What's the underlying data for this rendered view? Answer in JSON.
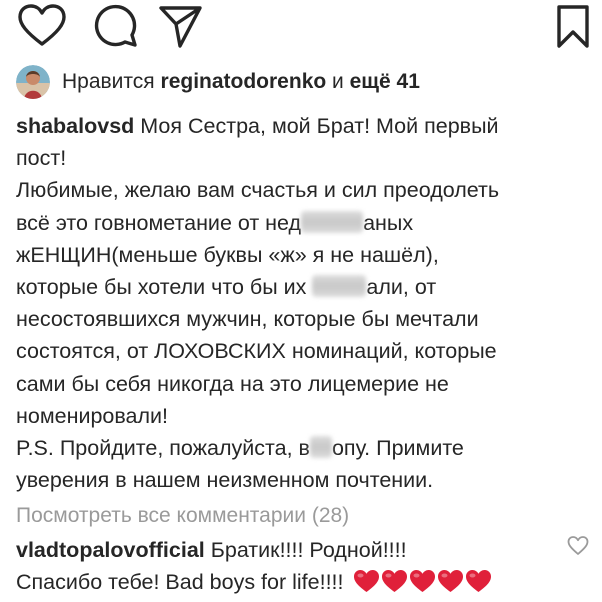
{
  "action_bar": {
    "icons": [
      "heart-icon",
      "comment-icon",
      "share-icon",
      "bookmark-icon"
    ]
  },
  "likes": {
    "prefix": "Нравится",
    "user": "reginatodorenko",
    "middle": "и",
    "more": "ещё 41"
  },
  "caption": {
    "username": "shabalovsd",
    "lines": [
      "Моя Сестра, мой Брат! Мой первый",
      "пост!",
      "Любимые, желаю вам счастья и сил преодолеть",
      "всё это говнометание от нед",
      "аных",
      "жЕНЩИН(меньше буквы «ж» я не нашёл),",
      "которые бы хотели что бы их",
      "али, от",
      "несостоявшихся мужчин, которые  бы мечтали",
      "состоятся, от ЛОХОВСКИХ номинаций, которые",
      "сами бы себя никогда на это лицемерие не",
      "номенировали!",
      "P.S. Пройдите, пожалуйста, в",
      "опу. Примите",
      "уверения в нашем неизменном почтении."
    ]
  },
  "view_comments": "Посмотреть все комментарии (28)",
  "comment": {
    "username": "vladtopalovofficial",
    "line1": "Братик!!!! Родной!!!!",
    "line2": "Спасибо тебе! Bad boys for life!!!!",
    "heart_count": 5,
    "heart_color": "#e0203a"
  },
  "colors": {
    "text": "#262626",
    "muted": "#9a9a9a",
    "heart": "#e0203a"
  }
}
